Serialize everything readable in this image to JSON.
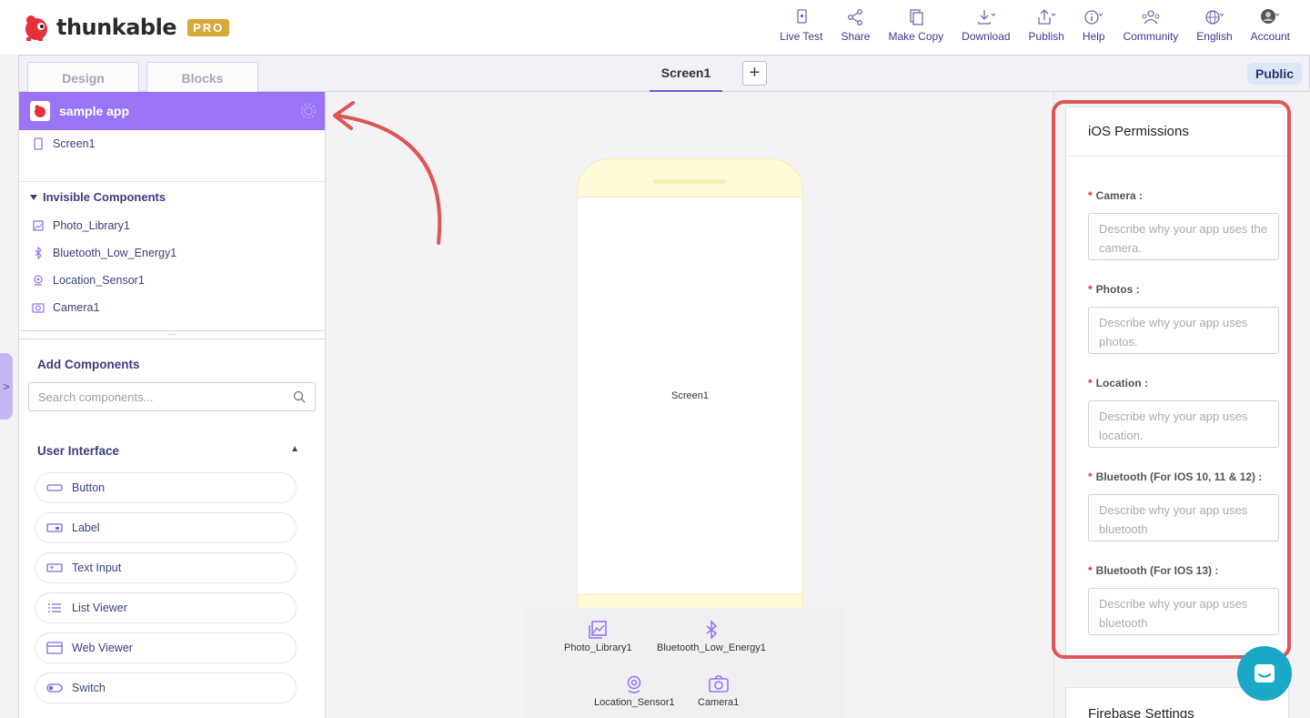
{
  "app": {
    "logo_text": "thunkable",
    "pro_badge": "PRO"
  },
  "nav": [
    {
      "label": "Live Test",
      "icon": "phone-icon"
    },
    {
      "label": "Share",
      "icon": "share-icon"
    },
    {
      "label": "Make Copy",
      "icon": "copy-icon"
    },
    {
      "label": "Download",
      "icon": "download-icon"
    },
    {
      "label": "Publish",
      "icon": "publish-icon"
    },
    {
      "label": "Help",
      "icon": "help-icon"
    },
    {
      "label": "Community",
      "icon": "community-icon"
    },
    {
      "label": "English",
      "icon": "globe-icon"
    },
    {
      "label": "Account",
      "icon": "avatar-icon"
    }
  ],
  "tabs": {
    "design": "Design",
    "blocks": "Blocks",
    "screen": "Screen1",
    "add": "+",
    "visibility": "Public"
  },
  "left": {
    "app_name": "sample app",
    "screens": [
      "Screen1"
    ],
    "invisible_title": "Invisible Components",
    "invisible": [
      "Photo_Library1",
      "Bluetooth_Low_Energy1",
      "Location_Sensor1",
      "Camera1"
    ],
    "add_title": "Add Components",
    "search_placeholder": "Search components...",
    "ui_title": "User Interface",
    "components": [
      "Button",
      "Label",
      "Text Input",
      "List Viewer",
      "Web Viewer",
      "Switch"
    ]
  },
  "canvas": {
    "screen_label": "Screen1",
    "tray": [
      "Photo_Library1",
      "Bluetooth_Low_Energy1",
      "Location_Sensor1",
      "Camera1"
    ]
  },
  "right": {
    "perm_title": "iOS Permissions",
    "fields": [
      {
        "label": "Camera :",
        "placeholder": "Describe why your app uses the camera."
      },
      {
        "label": "Photos :",
        "placeholder": "Describe why your app uses photos."
      },
      {
        "label": "Location :",
        "placeholder": "Describe why your app uses location."
      },
      {
        "label": "Bluetooth (For IOS 10, 11 & 12) :",
        "placeholder": "Describe why your app uses bluetooth"
      },
      {
        "label": "Bluetooth (For IOS 13) :",
        "placeholder": "Describe why your app uses bluetooth"
      }
    ],
    "firebase_title": "Firebase Settings"
  },
  "colors": {
    "accent": "#9a74f4",
    "nav_text": "#3a3a8c",
    "highlight": "#e05555",
    "chat": "#1aa8c6"
  }
}
